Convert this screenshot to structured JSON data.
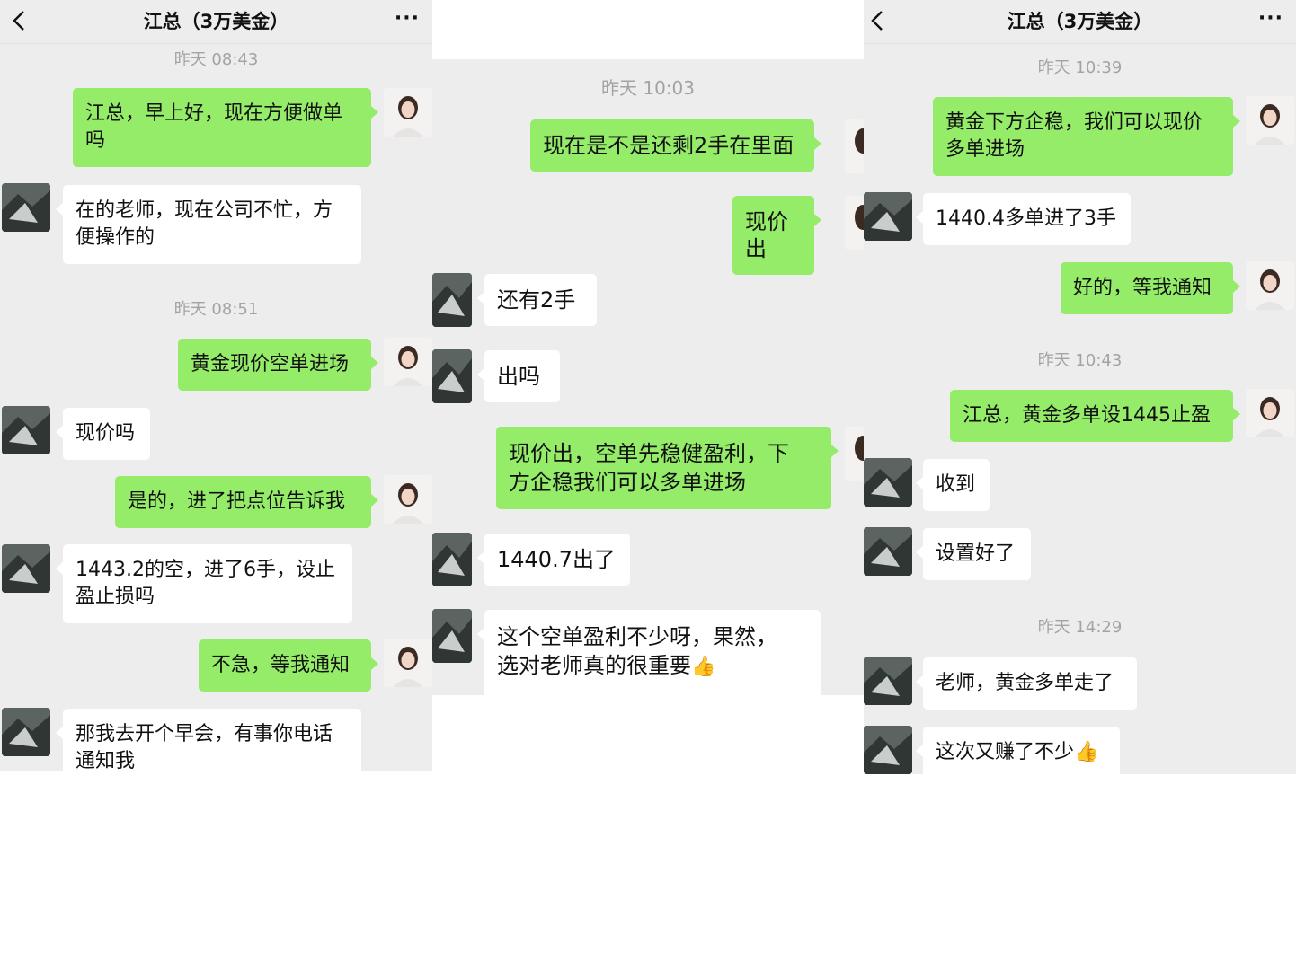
{
  "header": {
    "title": "江总（3万美金）",
    "more": "···",
    "back": "back-chevron-icon"
  },
  "panel1": {
    "timestamps": [
      "昨天 08:43",
      "昨天 08:51"
    ],
    "messages": [
      "江总，早上好，现在方便做单\n吗",
      "在的老师，现在公司不忙，方\n便操作的",
      "黄金现价空单进场",
      "现价吗",
      "是的，进了把点位告诉我",
      "1443.2的空，进了6手，设止\n盈止损吗",
      "不急，等我通知",
      "那我去开个早会，有事你电话\n通知我"
    ]
  },
  "panel2": {
    "timestamps": [
      "昨天 10:03"
    ],
    "messages": [
      "现在是不是还剩2手在里面",
      "现价出",
      "还有2手",
      "出吗",
      "现价出，空单先稳健盈利，下\n方企稳我们可以多单进场",
      "1440.7出了",
      "这个空单盈利不少呀，果然，\n选对老师真的很重要"
    ],
    "emoji": "👍"
  },
  "panel3": {
    "timestamps": [
      "昨天 10:39",
      "昨天 10:43",
      "昨天 14:29"
    ],
    "messages": [
      "黄金下方企稳，我们可以现价\n多单进场",
      "1440.4多单进了3手",
      "好的，等我通知",
      "江总，黄金多单设1445止盈",
      "收到",
      "设置好了",
      "老师，黄金多单走了",
      "这次又赚了不少"
    ],
    "emoji": "👍"
  },
  "colors": {
    "chat_bg": "#ededed",
    "outgoing_bubble": "#95ec69",
    "incoming_bubble": "#ffffff",
    "timestamp": "#a3a3a3"
  }
}
